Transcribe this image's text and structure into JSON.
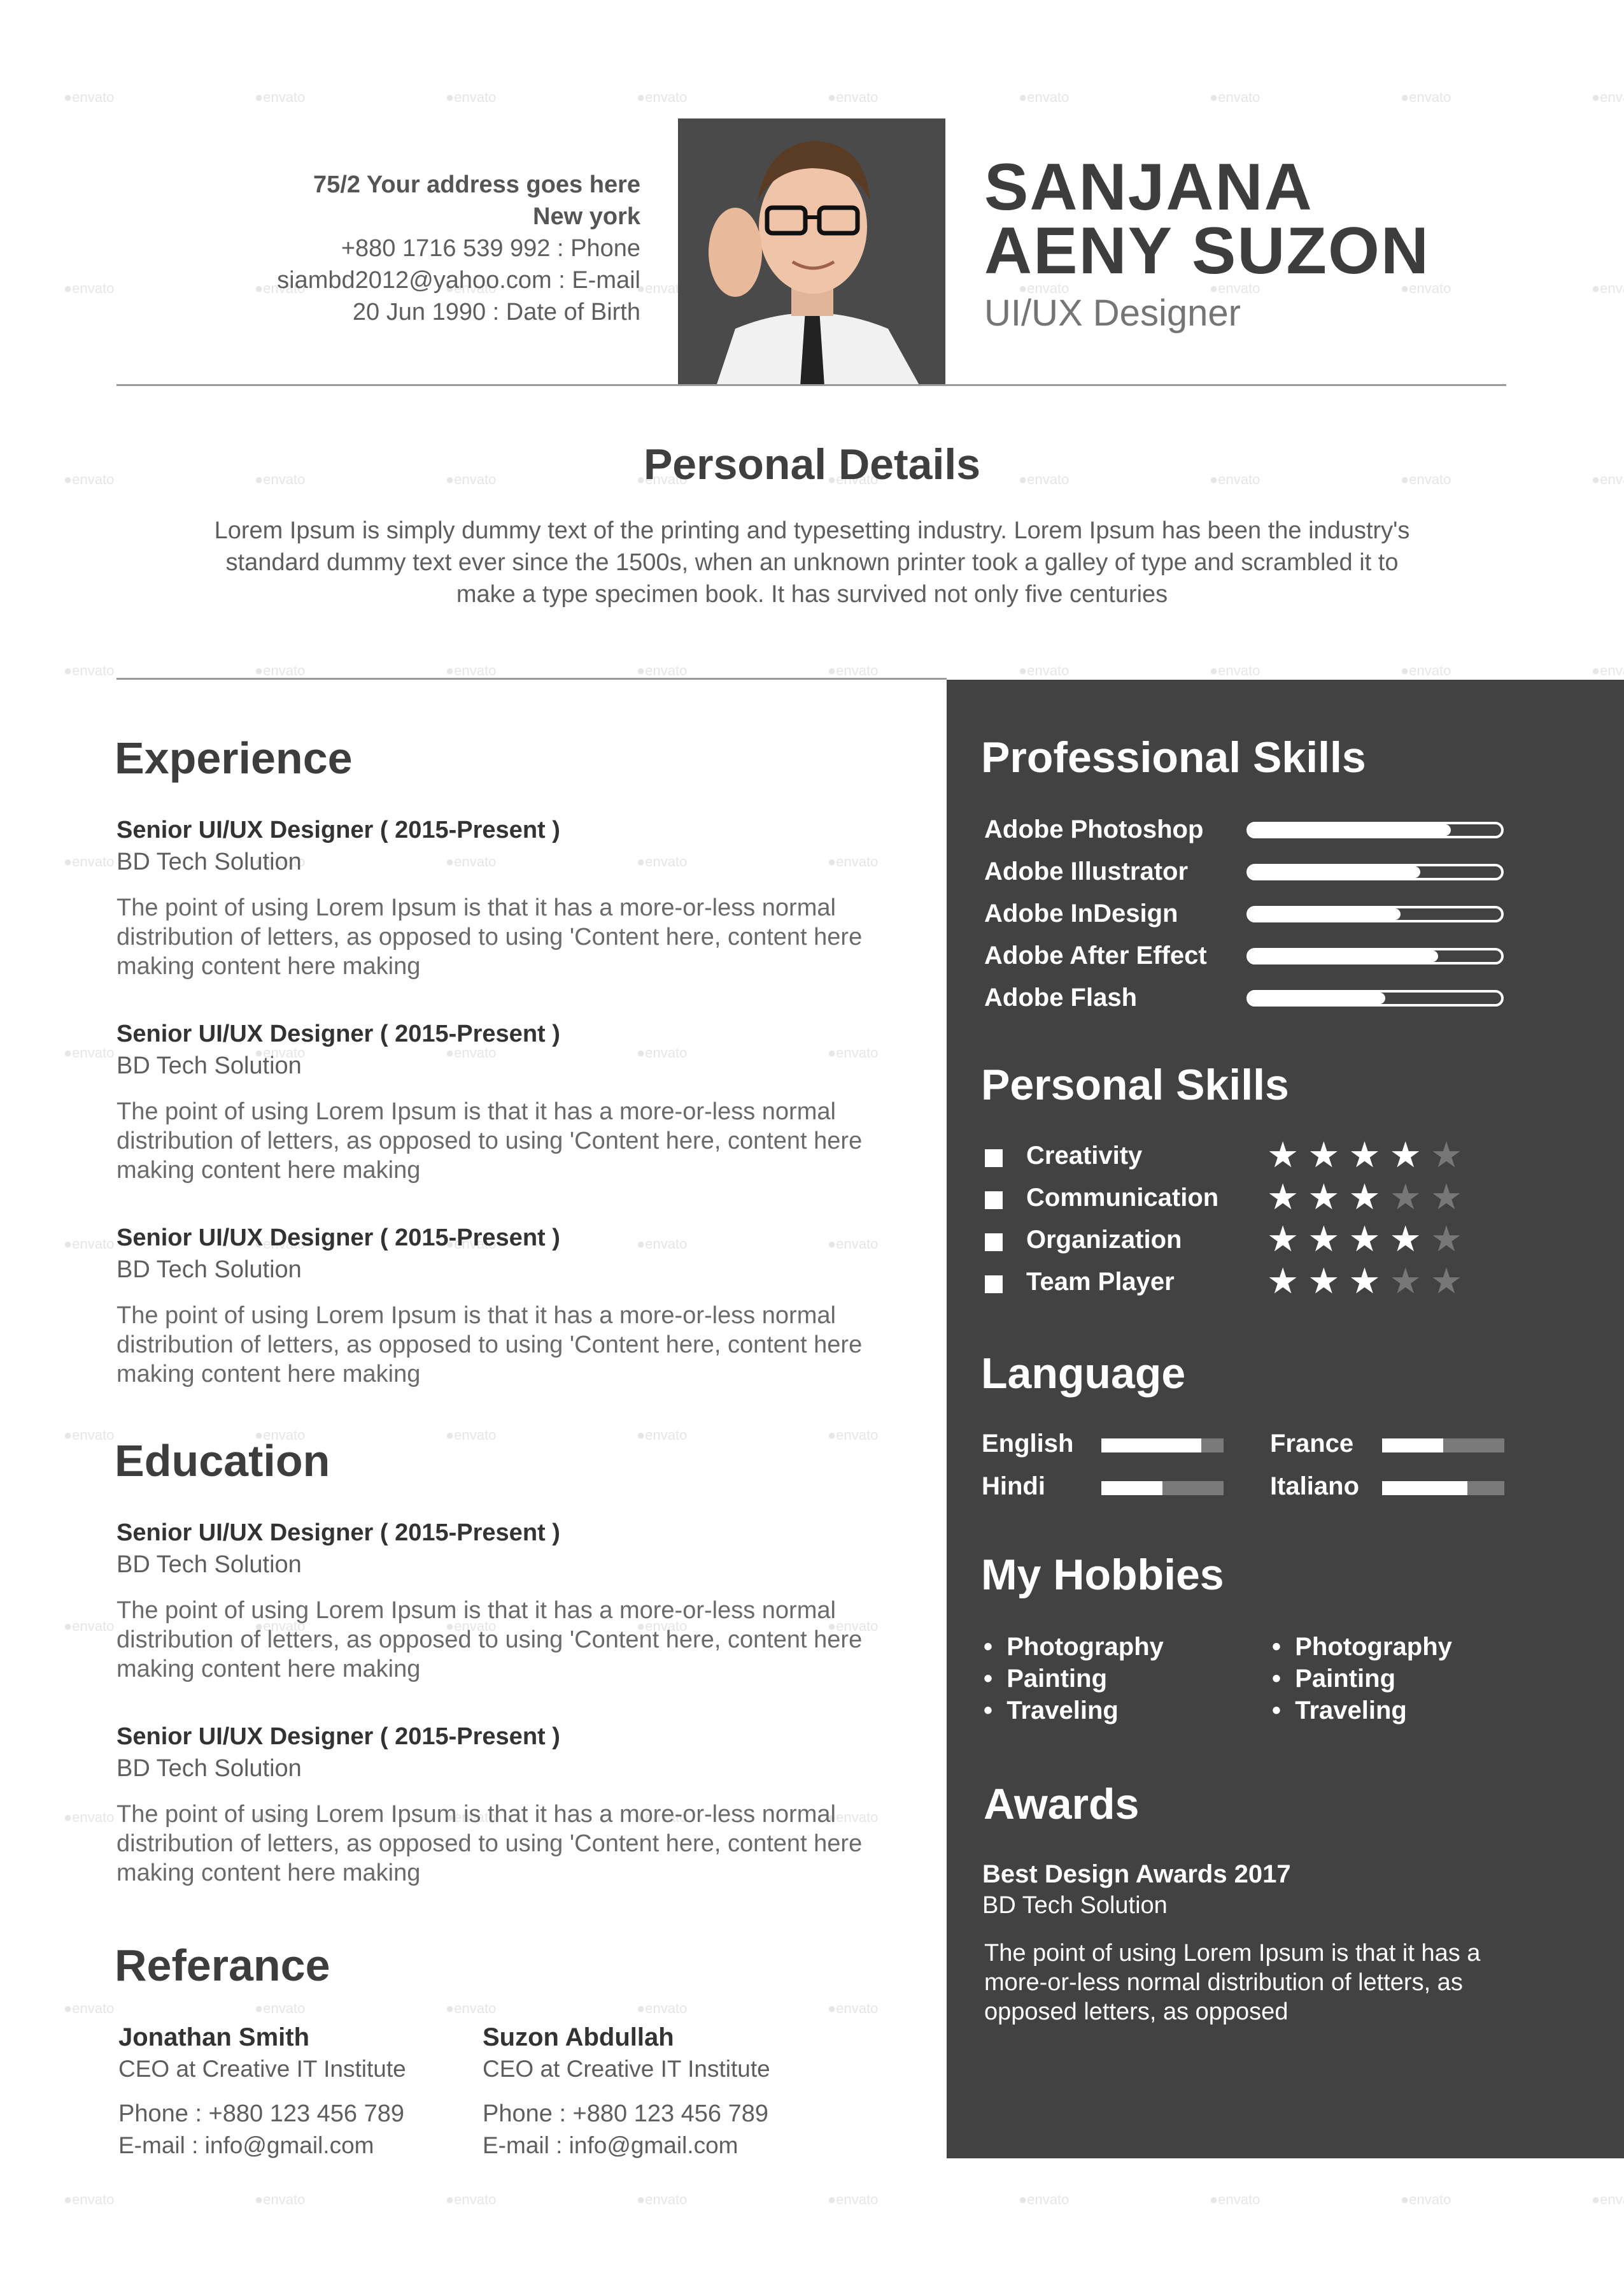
{
  "header": {
    "address": "75/2 Your address goes here",
    "city": "New york",
    "phone": "+880 1716 539 992 : Phone",
    "email": "siambd2012@yahoo.com : E-mail",
    "dob": "20 Jun 1990 : Date of Birth",
    "name_line1": "SANJANA",
    "name_line2": "AENY SUZON",
    "role": "UI/UX Designer"
  },
  "personal_details": {
    "title": "Personal Details",
    "text": "Lorem Ipsum is simply dummy text of the printing and typesetting industry. Lorem Ipsum has been the industry's standard dummy text ever since the 1500s, when an unknown printer took a galley of type and scrambled it to make a type specimen book. It has survived not only five centuries"
  },
  "experience": {
    "title": "Experience",
    "items": [
      {
        "title": "Senior UI/UX Designer ( 2015-Present )",
        "company": "BD Tech Solution",
        "desc": "The point of using Lorem Ipsum is that it has a more-or-less normal distribution of letters, as opposed to using 'Content here, content here making content here making"
      },
      {
        "title": "Senior UI/UX Designer ( 2015-Present )",
        "company": "BD Tech Solution",
        "desc": "The point of using Lorem Ipsum is that it has a more-or-less normal distribution of letters, as opposed to using 'Content here, content here making content here making"
      },
      {
        "title": "Senior UI/UX Designer ( 2015-Present )",
        "company": "BD Tech Solution",
        "desc": "The point of using Lorem Ipsum is that it has a more-or-less normal distribution of letters, as opposed to using 'Content here, content here making content here making"
      }
    ]
  },
  "education": {
    "title": "Education",
    "items": [
      {
        "title": "Senior UI/UX Designer ( 2015-Present )",
        "company": "BD Tech Solution",
        "desc": "The point of using Lorem Ipsum is that it has a more-or-less normal distribution of letters, as opposed to using 'Content here, content here making content here making"
      },
      {
        "title": "Senior UI/UX Designer ( 2015-Present )",
        "company": "BD Tech Solution",
        "desc": "The point of using Lorem Ipsum is that it has a more-or-less normal distribution of letters, as opposed to using 'Content here, content here making content here making"
      }
    ]
  },
  "reference": {
    "title": "Referance",
    "people": [
      {
        "name": "Jonathan Smith",
        "role": "CEO at Creative IT Institute",
        "phone": "Phone : +880 123 456 789",
        "email": "E-mail : info@gmail.com"
      },
      {
        "name": "Suzon Abdullah",
        "role": "CEO at Creative IT Institute",
        "phone": "Phone : +880 123 456 789",
        "email": "E-mail : info@gmail.com"
      }
    ]
  },
  "professional_skills": {
    "title": "Professional Skills",
    "items": [
      {
        "label": "Adobe Photoshop",
        "level": 0.8
      },
      {
        "label": "Adobe Illustrator",
        "level": 0.68
      },
      {
        "label": "Adobe InDesign",
        "level": 0.6
      },
      {
        "label": "Adobe After Effect",
        "level": 0.75
      },
      {
        "label": "Adobe Flash",
        "level": 0.54
      }
    ]
  },
  "personal_skills": {
    "title": "Personal Skills",
    "max_stars": 5,
    "items": [
      {
        "label": "Creativity",
        "stars": 4
      },
      {
        "label": "Communication",
        "stars": 3
      },
      {
        "label": "Organization",
        "stars": 4
      },
      {
        "label": "Team Player",
        "stars": 3
      }
    ]
  },
  "language": {
    "title": "Language",
    "items": [
      {
        "label": "English",
        "level": 0.82
      },
      {
        "label": "France",
        "level": 0.5
      },
      {
        "label": "Hindi",
        "level": 0.5
      },
      {
        "label": "Italiano",
        "level": 0.7
      }
    ]
  },
  "hobbies": {
    "title": "My Hobbies",
    "col1": [
      "Photography",
      "Painting",
      "Traveling"
    ],
    "col2": [
      "Photography",
      "Painting",
      "Traveling"
    ]
  },
  "awards": {
    "title": "Awards",
    "name": "Best Design Awards 2017",
    "company": "BD Tech Solution",
    "desc": "The point of using Lorem Ipsum is that it has a more-or-less normal distribution of letters, as opposed letters, as opposed"
  },
  "watermark": "envato",
  "colors": {
    "panel": "#424242",
    "text": "#4a4a4a",
    "white": "#ffffff"
  }
}
